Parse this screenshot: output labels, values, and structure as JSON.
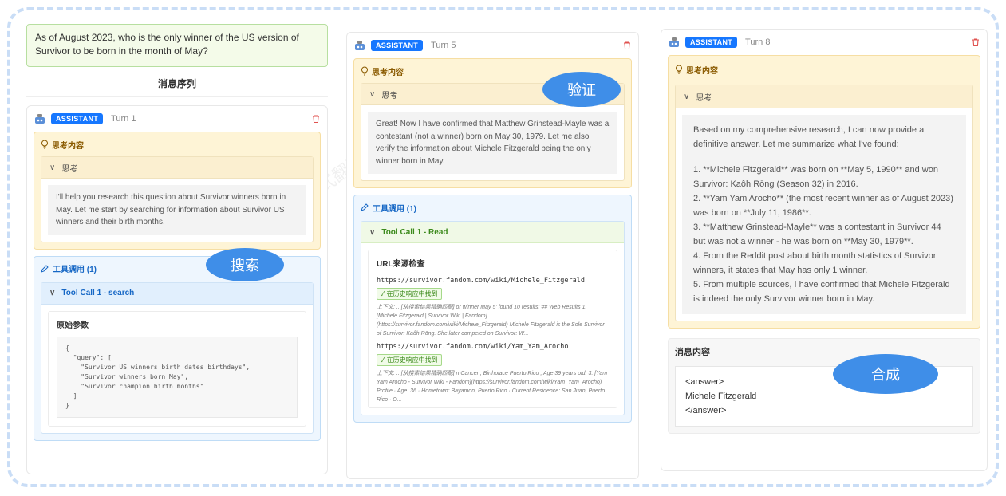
{
  "question": "As of August 2023, who is the only winner of the US version of Survivor to be born in the month of May?",
  "sequence_title": "消息序列",
  "labels": {
    "role": "ASSISTANT",
    "think_section": "思考内容",
    "think_toggle": "思考",
    "tool_section": "工具调用 (1)",
    "raw_params": "原始参数",
    "url_check": "URL来源检查",
    "found_badge": "✓ 在历史响应中找到",
    "message_content": "消息内容"
  },
  "turns": [
    {
      "turn_label": "Turn 1",
      "think_text": "I'll help you research this question about Survivor winners born in May. Let me start by searching for information about Survivor US winners and their birth months.",
      "tool_call_title": "Tool Call 1 - search",
      "raw_params_code": "{\n  \"query\": [\n    \"Survivor US winners birth dates birthdays\",\n    \"Survivor winners born May\",\n    \"Survivor champion birth months\"\n  ]\n}"
    },
    {
      "turn_label": "Turn 5",
      "think_text": "Great! Now I have confirmed that Matthew Grinstead-Mayle was a contestant (not a winner) born on May 30, 1979. Let me also verify the information about Michele Fitzgerald being the only winner born in May.",
      "tool_call_title": "Tool Call 1 - Read",
      "urls": [
        {
          "url": "https://survivor.fandom.com/wiki/Michele_Fitzgerald",
          "context": "上下文: ...[从搜索结果精确匹配] or winner May 5' found 10 results: ## Web Results 1. [Michele Fitzgerald | Survivor Wiki | Fandom](https://survivor.fandom.com/wiki/Michele_Fitzgerald) Michele Fitzgerald is the Sole Survivor of Survivor: Kaôh Rōng. She later competed on Survivor: W..."
        },
        {
          "url": "https://survivor.fandom.com/wiki/Yam_Yam_Arocho",
          "context": "上下文: ...[从搜索结果精确匹配] n Cancer ; Birthplace Puerto Rico ; Age 39 years old. 3. [Yam Yam Arocho - Survivor Wiki - Fandom](https://survivor.fandom.com/wiki/Yam_Yam_Arocho) Profile · Age: 36 · Hometown: Bayamon, Puerto Rico · Current Residence: San Juan, Puerto Rico · O..."
        }
      ]
    },
    {
      "turn_label": "Turn 8",
      "think_lines": [
        "Based on my comprehensive research, I can now provide a definitive answer. Let me summarize what I've found:",
        "1. **Michele Fitzgerald** was born on **May 5, 1990** and won Survivor: Kaôh Rōng (Season 32) in 2016.",
        "2. **Yam Yam Arocho** (the most recent winner as of August 2023) was born on **July 11, 1986**.",
        "3. **Matthew Grinstead-Mayle** was a contestant in Survivor 44 but was not a winner - he was born on **May 30, 1979**.",
        "4. From the Reddit post about birth month statistics of Survivor winners, it states that May has only 1 winner.",
        "5. From multiple sources, I have confirmed that Michele Fitzgerald is indeed the only Survivor winner born in May."
      ],
      "answer_lines": [
        "<answer>",
        "Michele Fitzgerald",
        "</answer>"
      ]
    }
  ],
  "annotations": {
    "search": "搜索",
    "verify": "验证",
    "synthesize": "合成"
  },
  "colors": {
    "accent": "#1677ff",
    "annotation_bubble": "#3f8ee8",
    "think_bg": "#fef4d6",
    "tool_bg": "#eef6fe"
  }
}
